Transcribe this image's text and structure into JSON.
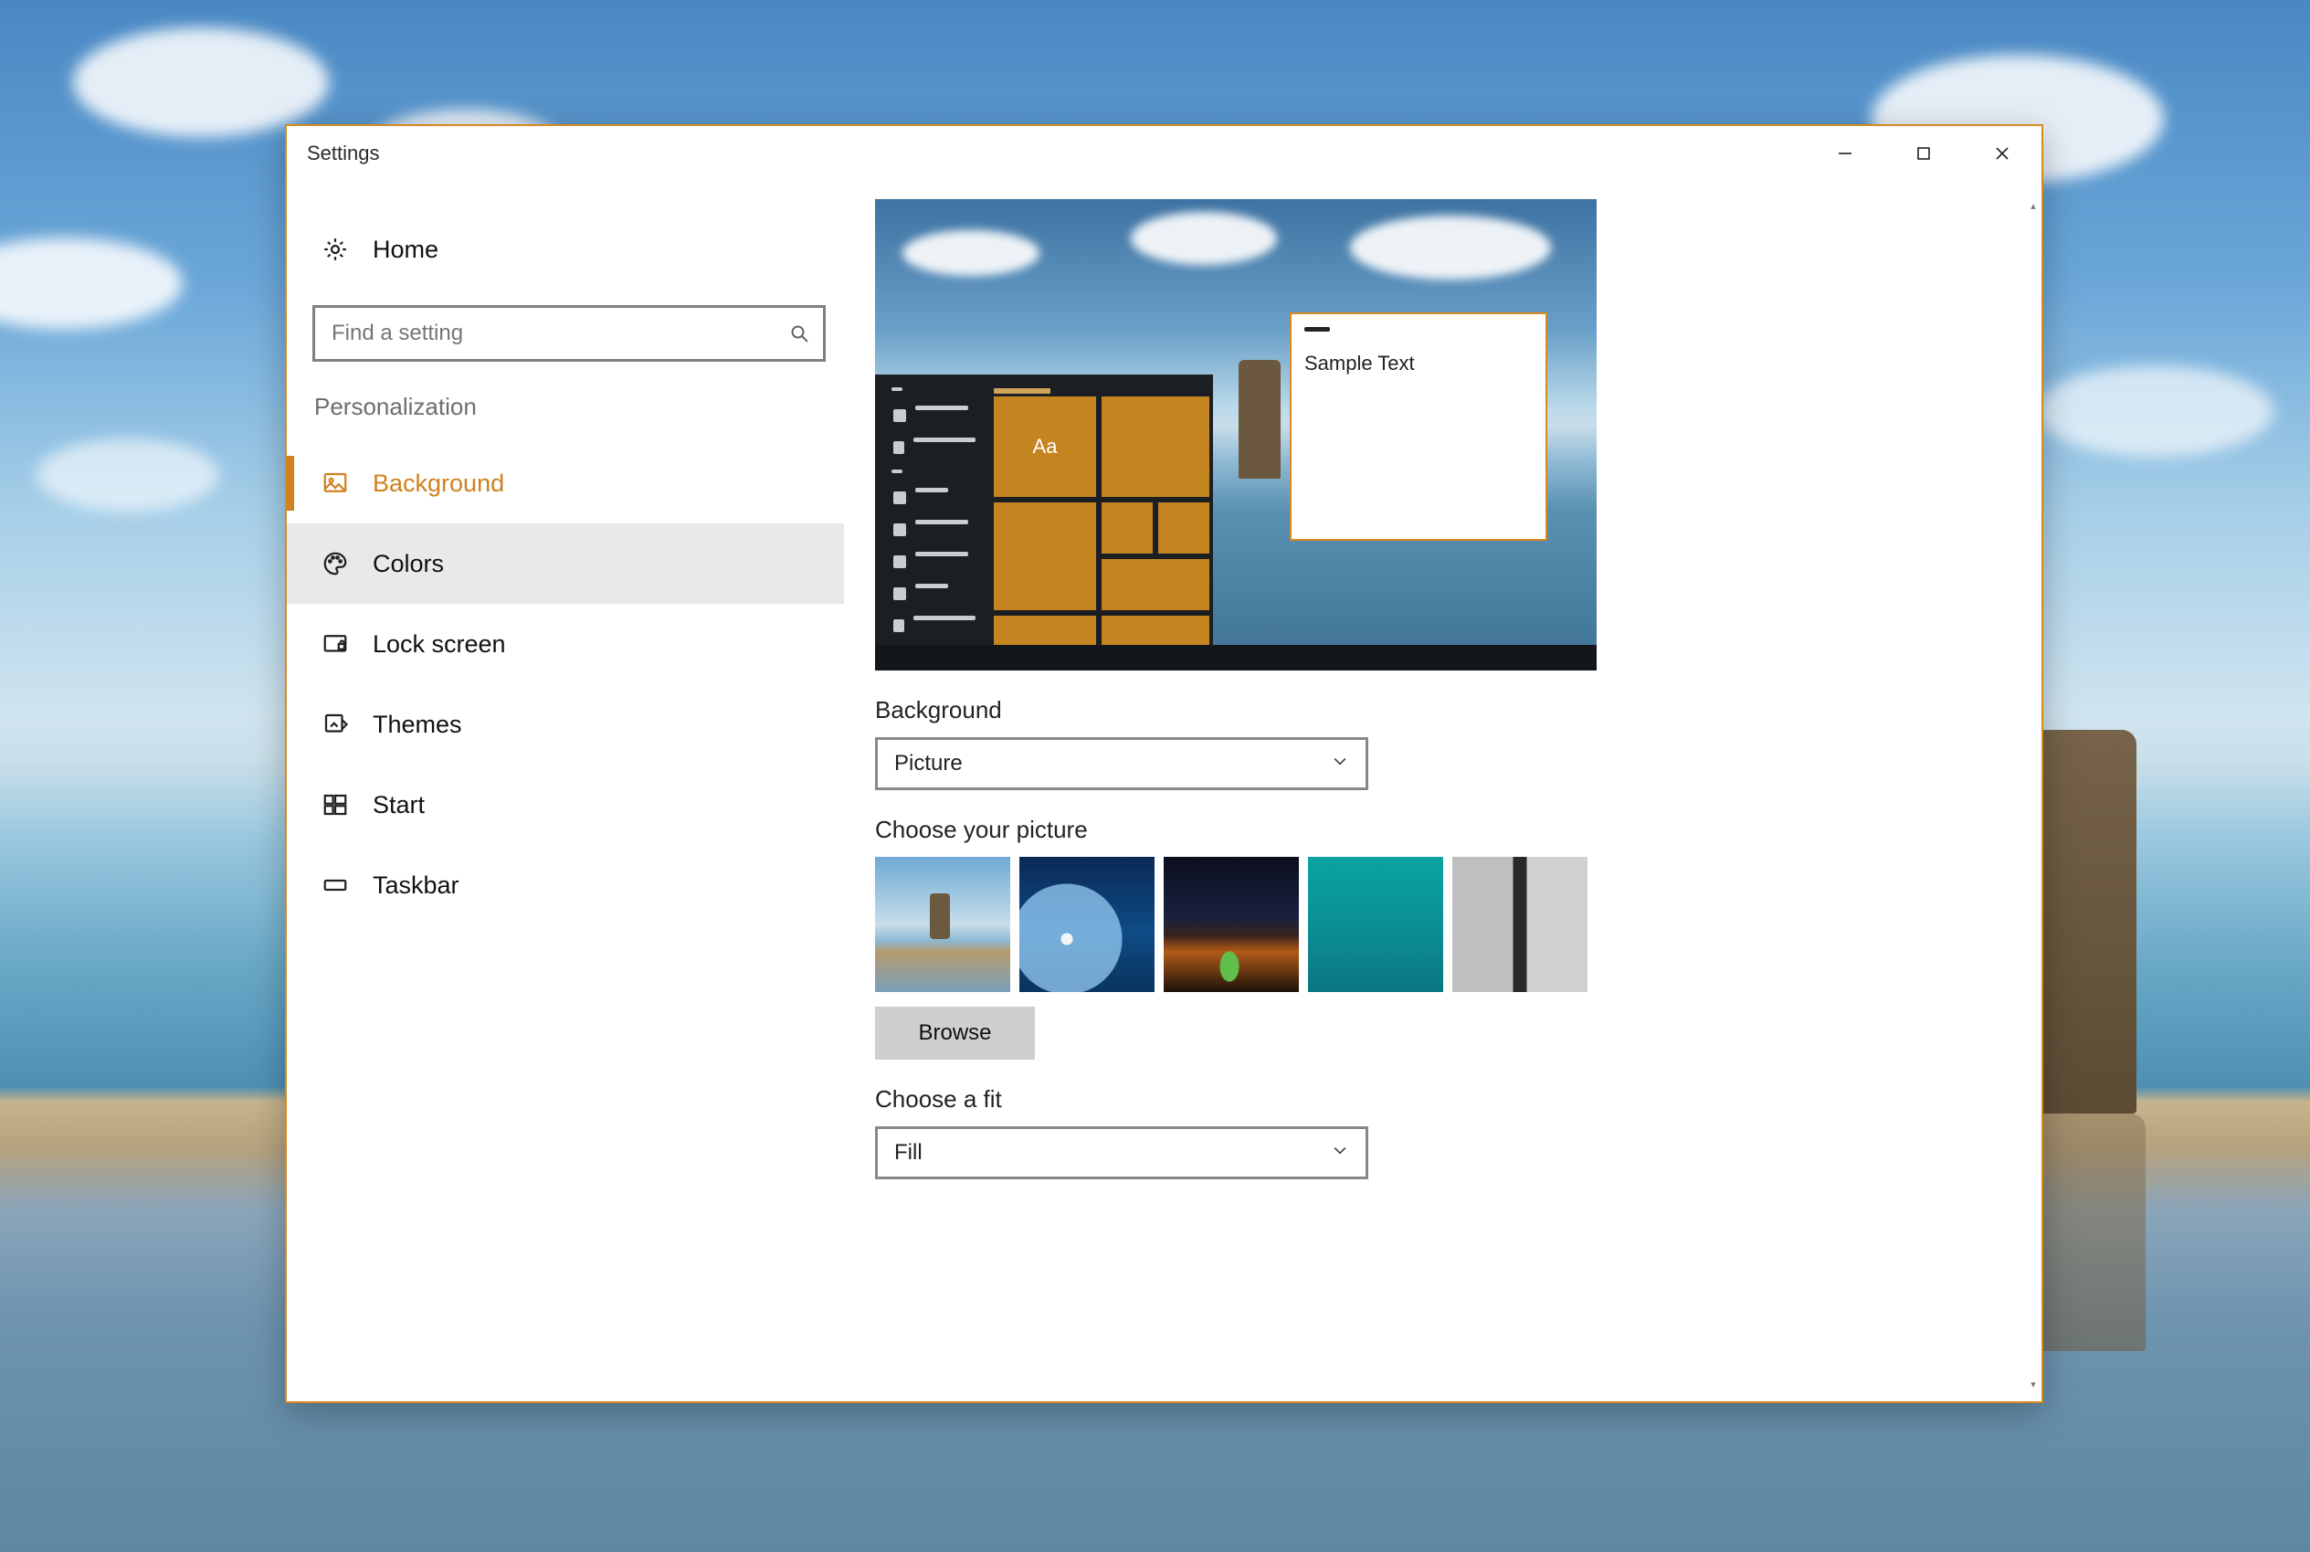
{
  "window": {
    "title": "Settings"
  },
  "home_label": "Home",
  "search": {
    "placeholder": "Find a setting"
  },
  "sidebar": {
    "section": "Personalization",
    "items": [
      {
        "label": "Background",
        "state": "active"
      },
      {
        "label": "Colors",
        "state": "hover"
      },
      {
        "label": "Lock screen",
        "state": ""
      },
      {
        "label": "Themes",
        "state": ""
      },
      {
        "label": "Start",
        "state": ""
      },
      {
        "label": "Taskbar",
        "state": ""
      }
    ]
  },
  "preview": {
    "sample_text": "Sample Text",
    "tile_text": "Aa"
  },
  "content": {
    "background_label": "Background",
    "background_value": "Picture",
    "choose_picture_label": "Choose your picture",
    "browse_label": "Browse",
    "fit_label": "Choose a fit",
    "fit_value": "Fill"
  },
  "accent_color": "#d1801e"
}
